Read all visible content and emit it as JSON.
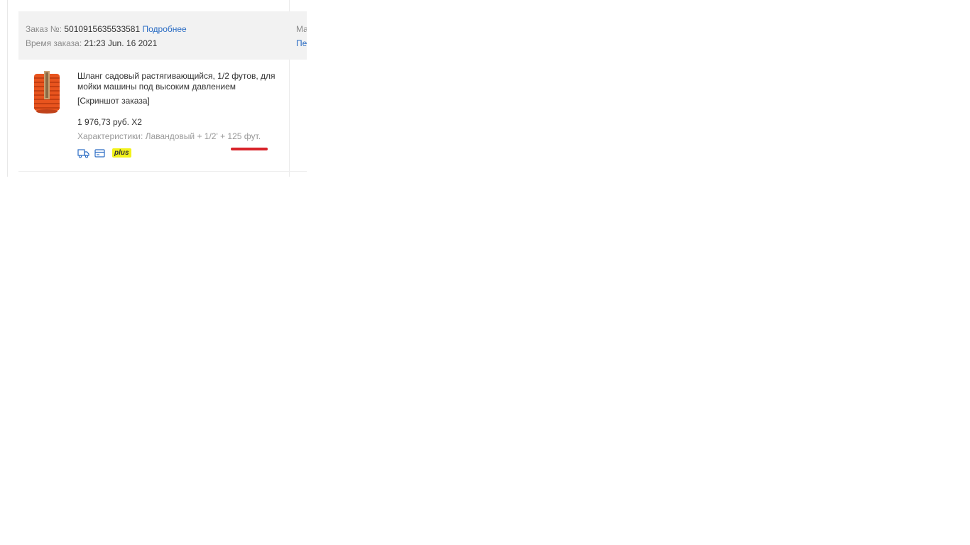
{
  "order": {
    "number_label": "Заказ №:",
    "number": "5010915635533581",
    "details_link": "Подробнее",
    "time_label": "Время заказа:",
    "time": "21:23 Jun. 16 2021",
    "right_col_top": "Ма",
    "right_col_link": "Пе"
  },
  "item": {
    "title": "Шланг садовый растягивающийся, 1/2 футов, для мойки машины под высоким давлением",
    "snapshot_link": "[Скриншот заказа]",
    "price": "1 976,73 руб. X2",
    "specs": "Характеристики: Лавандовый + 1/2' + 125 фут.",
    "badge": "plus",
    "icons": [
      "truck-icon",
      "card-icon"
    ]
  },
  "colors": {
    "link": "#2a6cc4",
    "header_bg": "#f2f2f2",
    "highlight_red": "#d8232a",
    "plus_yellow": "#f2f21a",
    "product_orange": "#e8541e"
  }
}
